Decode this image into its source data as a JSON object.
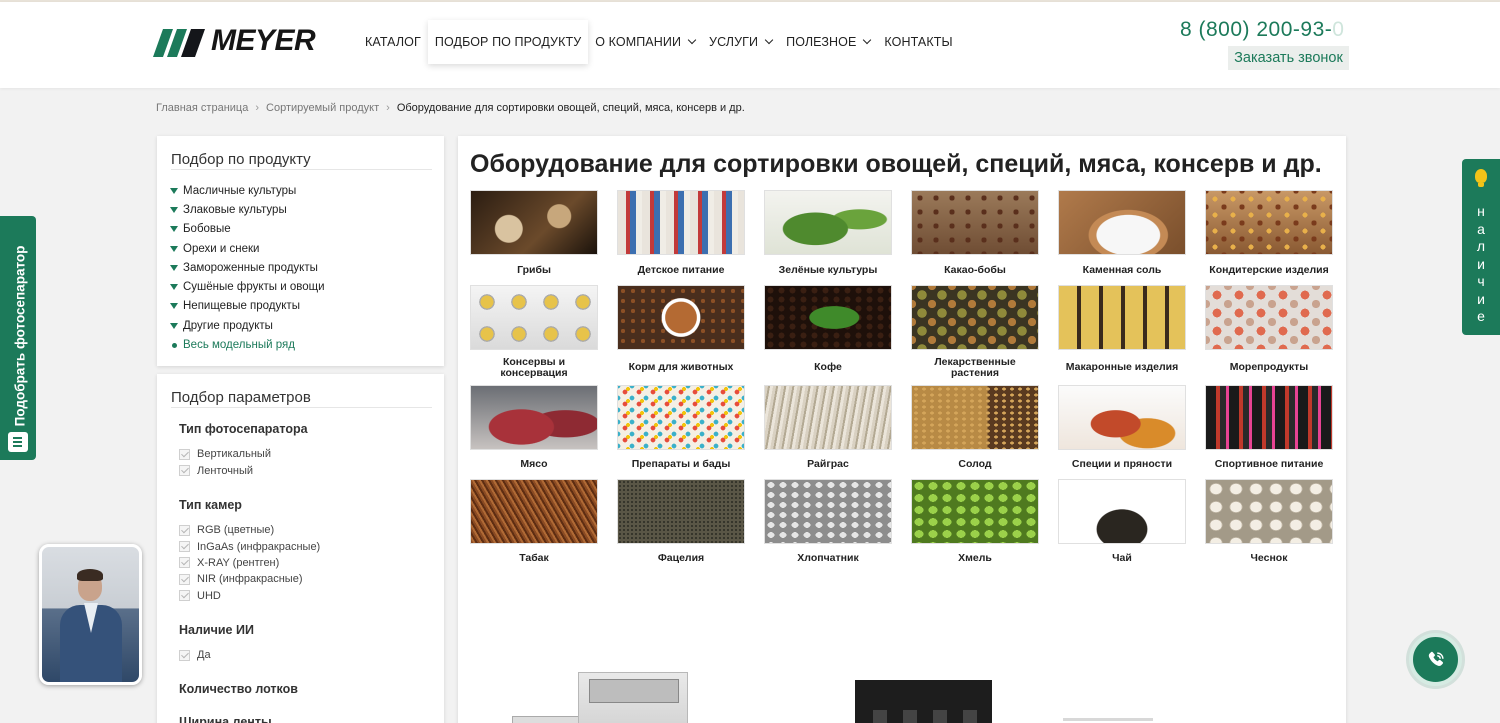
{
  "header": {
    "logo_text": "MEYER",
    "nav": [
      {
        "label": "КАТАЛОГ",
        "dropdown": false,
        "active": false
      },
      {
        "label": "ПОДБОР ПО ПРОДУКТУ",
        "dropdown": false,
        "active": true
      },
      {
        "label": "О КОМПАНИИ",
        "dropdown": true,
        "active": false
      },
      {
        "label": "УСЛУГИ",
        "dropdown": true,
        "active": false
      },
      {
        "label": "ПОЛЕЗНОЕ",
        "dropdown": true,
        "active": false
      },
      {
        "label": "КОНТАКТЫ",
        "dropdown": false,
        "active": false
      }
    ],
    "phone_main": "8 (800) 200-93-",
    "phone_fade": "0",
    "callback_label": "Заказать звонок"
  },
  "breadcrumb": {
    "items": [
      "Главная страница",
      "Сортируемый продукт"
    ],
    "current": "Оборудование для сортировки овощей, специй, мяса, консерв и др."
  },
  "sidebar": {
    "products_title": "Подбор по продукту",
    "categories": [
      "Масличные культуры",
      "Злаковые культуры",
      "Бобовые",
      "Орехи и снеки",
      "Замороженные продукты",
      "Сушёные фрукты и овощи",
      "Непищевые продукты",
      "Другие продукты"
    ],
    "all_models_label": "Весь модельный ряд",
    "params_title": "Подбор параметров",
    "groups": [
      {
        "title": "Тип фотосепаратора",
        "options": [
          "Вертикальный",
          "Ленточный"
        ]
      },
      {
        "title": "Тип камер",
        "options": [
          "RGB (цветные)",
          "InGaAs (инфракрасные)",
          "X-RAY (рентген)",
          "NIR (инфракрасные)",
          "UHD"
        ]
      },
      {
        "title": "Наличие ИИ",
        "options": [
          "Да"
        ]
      },
      {
        "title": "Количество лотков",
        "options": []
      },
      {
        "title": "Ширина ленты",
        "options": []
      }
    ]
  },
  "main": {
    "title": "Оборудование для сортировки овощей, специй, мяса, консерв и др.",
    "tiles": [
      "Грибы",
      "Детское питание",
      "Зелёные культуры",
      "Какао-бобы",
      "Каменная соль",
      "Кондитерские изделия",
      "Консервы и консервация",
      "Корм для животных",
      "Кофе",
      "Лекарственные растения",
      "Макаронные изделия",
      "Морепродукты",
      "Мясо",
      "Препараты и бады",
      "Райграс",
      "Солод",
      "Специи и пряности",
      "Спортивное питание",
      "Табак",
      "Фацелия",
      "Хлопчатник",
      "Хмель",
      "Чай",
      "Чеснок"
    ]
  },
  "side": {
    "left_tab_label": "Подобрать фотосепаратор",
    "right_tab_label": "Наличие"
  },
  "colors": {
    "brand": "#1c7a5a",
    "bulb": "#f2c318"
  }
}
